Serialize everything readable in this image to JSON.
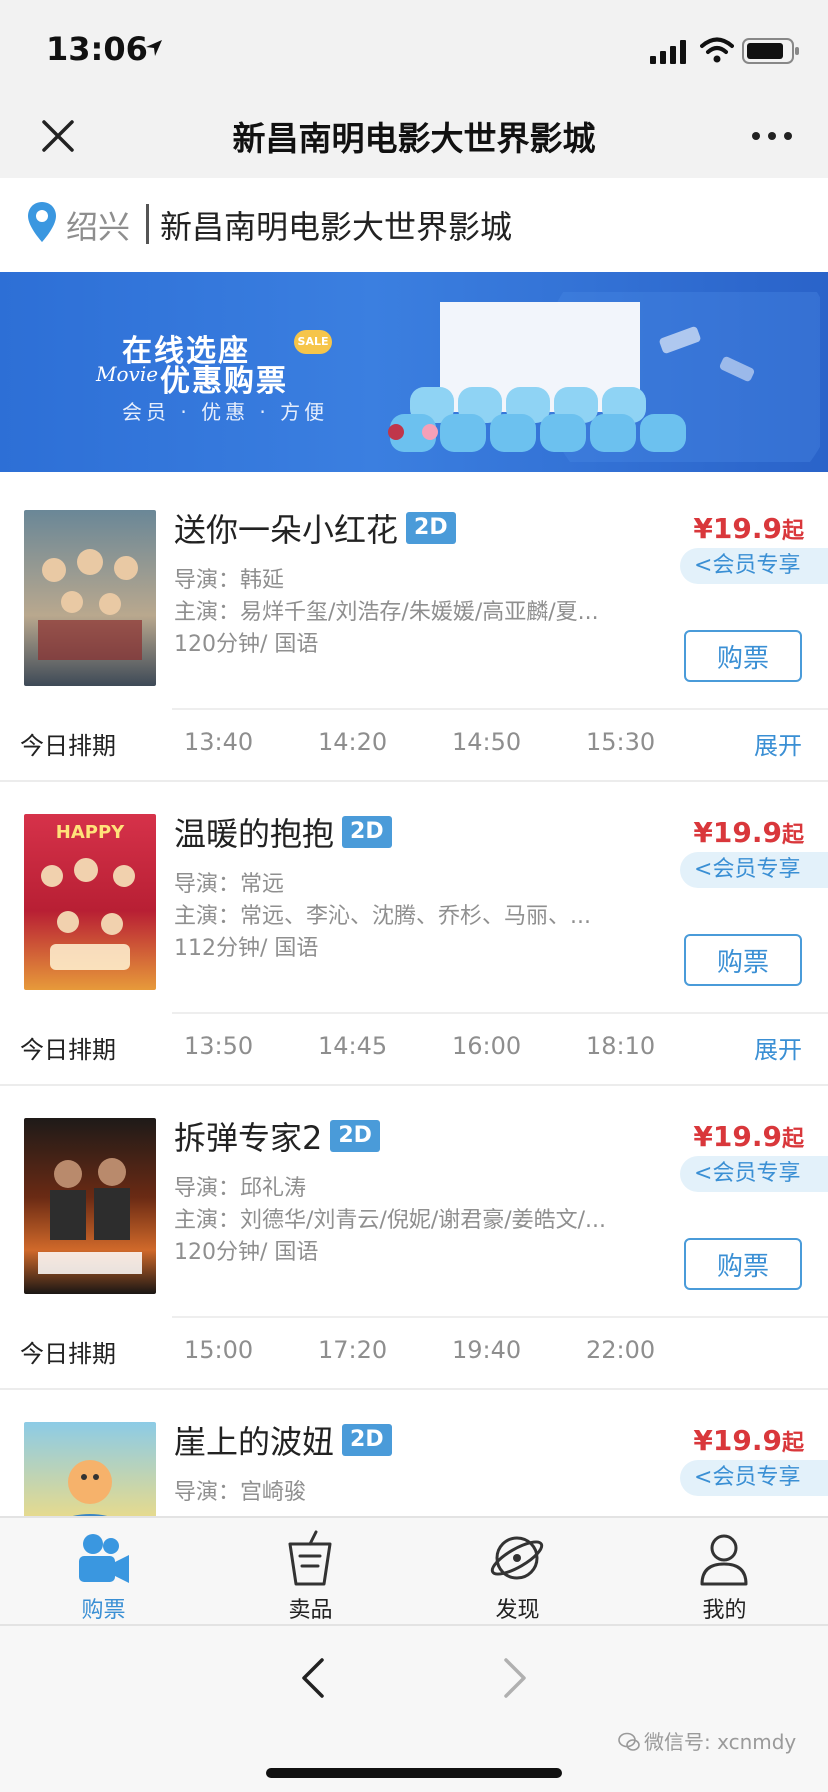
{
  "status_bar": {
    "time": "13:06"
  },
  "nav": {
    "title": "新昌南明电影大世界影城"
  },
  "location": {
    "city": "绍兴",
    "cinema": "新昌南明电影大世界影城"
  },
  "banner": {
    "line1": "在线选座",
    "sale": "SALE",
    "movie_word": "Movie",
    "line2": "优惠购票",
    "line3": "会员 · 优惠 · 方便"
  },
  "movies": [
    {
      "title": "送你一朵小红花",
      "format": "2D",
      "director": "导演：韩延",
      "cast": "主演：易烊千玺/刘浩存/朱媛媛/高亚麟/夏...",
      "info": "120分钟/ 国语",
      "price": "¥19.9",
      "price_suffix": "起",
      "member": "会员专享",
      "buy": "购票",
      "schedule_label": "今日排期",
      "times": [
        "13:40",
        "14:20",
        "14:50",
        "15:30"
      ],
      "expand": "展开",
      "poster_colors": [
        "#5c7a8e",
        "#c9b59a"
      ]
    },
    {
      "title": "温暖的抱抱",
      "format": "2D",
      "director": "导演：常远",
      "cast": "主演：常远、李沁、沈腾、乔杉、马丽、...",
      "info": "112分钟/ 国语",
      "price": "¥19.9",
      "price_suffix": "起",
      "member": "会员专享",
      "buy": "购票",
      "schedule_label": "今日排期",
      "times": [
        "13:50",
        "14:45",
        "16:00",
        "18:10"
      ],
      "expand": "展开",
      "poster_colors": [
        "#c2233a",
        "#e8a33c"
      ]
    },
    {
      "title": "拆弹专家2",
      "format": "2D",
      "director": "导演：邱礼涛",
      "cast": "主演：刘德华/刘青云/倪妮/谢君豪/姜皓文/...",
      "info": "120分钟/ 国语",
      "price": "¥19.9",
      "price_suffix": "起",
      "member": "会员专享",
      "buy": "购票",
      "schedule_label": "今日排期",
      "times": [
        "15:00",
        "17:20",
        "19:40",
        "22:00"
      ],
      "expand": "",
      "poster_colors": [
        "#2b2420",
        "#c65a22"
      ]
    },
    {
      "title": "崖上的波妞",
      "format": "2D",
      "director": "导演：宫崎骏",
      "cast": "",
      "info": "",
      "price": "¥19.9",
      "price_suffix": "起",
      "member": "会员专享",
      "buy": "",
      "schedule_label": "",
      "times": [],
      "expand": "",
      "poster_colors": [
        "#6fb7d6",
        "#e9d37a"
      ]
    }
  ],
  "tabs": [
    {
      "label": "购票",
      "icon": "camera-icon",
      "active": true
    },
    {
      "label": "卖品",
      "icon": "popcorn-icon",
      "active": false
    },
    {
      "label": "发现",
      "icon": "planet-icon",
      "active": false
    },
    {
      "label": "我的",
      "icon": "user-icon",
      "active": false
    }
  ],
  "watermark": "微信号: xcnmdy",
  "colors": {
    "accent": "#3a8fd4",
    "price": "#d9373b",
    "badge": "#4a9bd9"
  }
}
